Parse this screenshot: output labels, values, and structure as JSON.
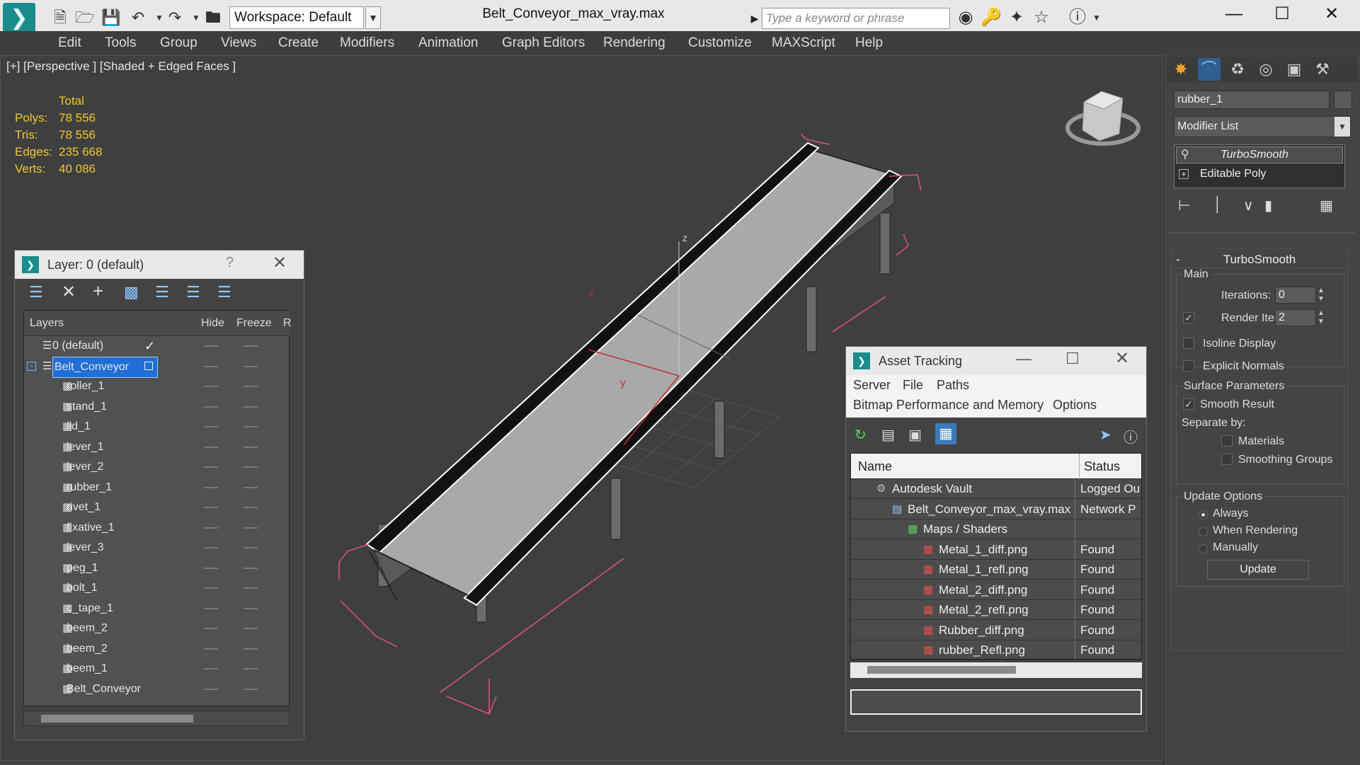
{
  "app": {
    "title": "Belt_Conveyor_max_vray.max",
    "workspace": "Workspace: Default",
    "search_placeholder": "Type a keyword or phrase",
    "window_controls": [
      "minimize-icon",
      "maximize-icon",
      "close-icon"
    ]
  },
  "menu": [
    "Edit",
    "Tools",
    "Group",
    "Views",
    "Create",
    "Modifiers",
    "Animation",
    "Graph Editors",
    "Rendering",
    "Customize",
    "MAXScript",
    "Help"
  ],
  "viewport": {
    "label": "[+] [Perspective ] [Shaded + Edged Faces ]",
    "stats": {
      "header": "Total",
      "rows": [
        {
          "key": "Polys:",
          "value": "78 556"
        },
        {
          "key": "Tris:",
          "value": "78 556"
        },
        {
          "key": "Edges:",
          "value": "235 668"
        },
        {
          "key": "Verts:",
          "value": "40 086"
        }
      ]
    },
    "gizmo": {
      "x": "x",
      "y": "y",
      "z": "z"
    }
  },
  "layer_window": {
    "title": "Layer: 0 (default)",
    "help": "?",
    "columns": [
      "Layers",
      "Hide",
      "Freeze",
      "R"
    ],
    "layers": [
      {
        "name": "0 (default)",
        "checked": true,
        "level": 0
      },
      {
        "name": "Belt_Conveyor",
        "selected": true,
        "level": 0
      },
      {
        "name": "roller_1",
        "level": 1
      },
      {
        "name": "stand_1",
        "level": 1
      },
      {
        "name": "lid_1",
        "level": 1
      },
      {
        "name": "lever_1",
        "level": 1
      },
      {
        "name": "lever_2",
        "level": 1
      },
      {
        "name": "rubber_1",
        "level": 1
      },
      {
        "name": "rivet_1",
        "level": 1
      },
      {
        "name": "fixative_1",
        "level": 1
      },
      {
        "name": "lever_3",
        "level": 1
      },
      {
        "name": "peg_1",
        "level": 1
      },
      {
        "name": "bolt_1",
        "level": 1
      },
      {
        "name": "c_tape_1",
        "level": 1
      },
      {
        "name": "beem_2",
        "level": 1
      },
      {
        "name": "beem_2",
        "level": 1
      },
      {
        "name": "beem_1",
        "level": 1
      },
      {
        "name": "Belt_Conveyor",
        "level": 1
      }
    ]
  },
  "asset_window": {
    "title": "Asset Tracking",
    "menu1": [
      "Server",
      "File",
      "Paths"
    ],
    "menu2": [
      "Bitmap Performance and Memory",
      "Options"
    ],
    "columns": [
      "Name",
      "Status"
    ],
    "rows": [
      {
        "name": "Autodesk Vault",
        "status": "Logged Ou",
        "indent": 1,
        "icon": "vault-icon"
      },
      {
        "name": "Belt_Conveyor_max_vray.max",
        "status": "Network P",
        "indent": 2,
        "icon": "max-file-icon"
      },
      {
        "name": "Maps / Shaders",
        "status": "",
        "indent": 3,
        "icon": "maps-icon"
      },
      {
        "name": "Metal_1_diff.png",
        "status": "Found",
        "indent": 4,
        "icon": "png-icon"
      },
      {
        "name": "Metal_1_refl.png",
        "status": "Found",
        "indent": 4,
        "icon": "png-icon"
      },
      {
        "name": "Metal_2_diff.png",
        "status": "Found",
        "indent": 4,
        "icon": "png-icon"
      },
      {
        "name": "Metal_2_refl.png",
        "status": "Found",
        "indent": 4,
        "icon": "png-icon"
      },
      {
        "name": "Rubber_diff.png",
        "status": "Found",
        "indent": 4,
        "icon": "png-icon"
      },
      {
        "name": "rubber_Refl.png",
        "status": "Found",
        "indent": 4,
        "icon": "png-icon"
      }
    ]
  },
  "command_panel": {
    "object_name": "rubber_1",
    "modifier_list": "Modifier List",
    "stack": [
      "TurboSmooth",
      "Editable Poly"
    ],
    "rollout": "TurboSmooth",
    "main_label": "Main",
    "iterations_label": "Iterations:",
    "iterations": "0",
    "render_iters_label": "Render Iters:",
    "render_iters": "2",
    "render_iters_checked": true,
    "isoline": "Isoline Display",
    "explicit_normals": "Explicit Normals",
    "surface_params": "Surface Parameters",
    "smooth_result": "Smooth Result",
    "separate_by": "Separate by:",
    "materials": "Materials",
    "smoothing_groups": "Smoothing Groups",
    "update_options": "Update Options",
    "always": "Always",
    "when_rendering": "When Rendering",
    "manually": "Manually",
    "update_button": "Update",
    "collapse": "-"
  },
  "colors": {
    "selection": "#1f6fd6",
    "stats": "#f0c830",
    "bounding_box": "#e0508a"
  }
}
